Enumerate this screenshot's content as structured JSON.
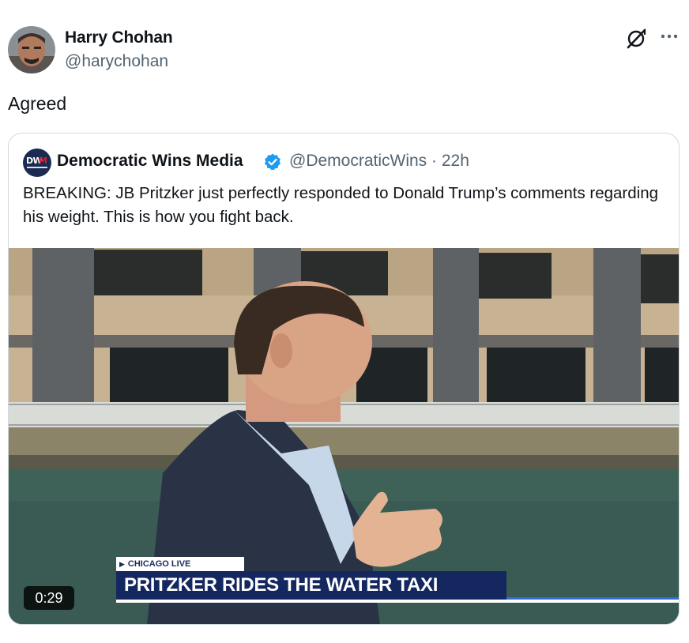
{
  "post": {
    "author_name": "Harry Chohan",
    "author_handle": "@harychohan",
    "text": "Agreed",
    "avatar_icon": "user-avatar-photo",
    "grok_icon": "grok-icon",
    "more_icon": "more-options-icon"
  },
  "quote": {
    "author_name": "Democratic Wins Media",
    "avatar_text_1": "DW",
    "avatar_text_2": "M",
    "verified": true,
    "meta": "@DemocraticWins · 22h",
    "text": "BREAKING: JB Pritzker just perfectly responded to Donald Trump’s comments regarding his weight. This is how you fight back.",
    "video": {
      "duration": "0:29",
      "lower_third_kicker": "CHICAGO LIVE",
      "lower_third_title": "PRITZKER RIDES THE WATER TAXI"
    }
  },
  "colors": {
    "verified": "#1d9bf0",
    "secondary_text": "#536471",
    "border": "#cfd9de",
    "lower_third_bg": "#14285f"
  }
}
